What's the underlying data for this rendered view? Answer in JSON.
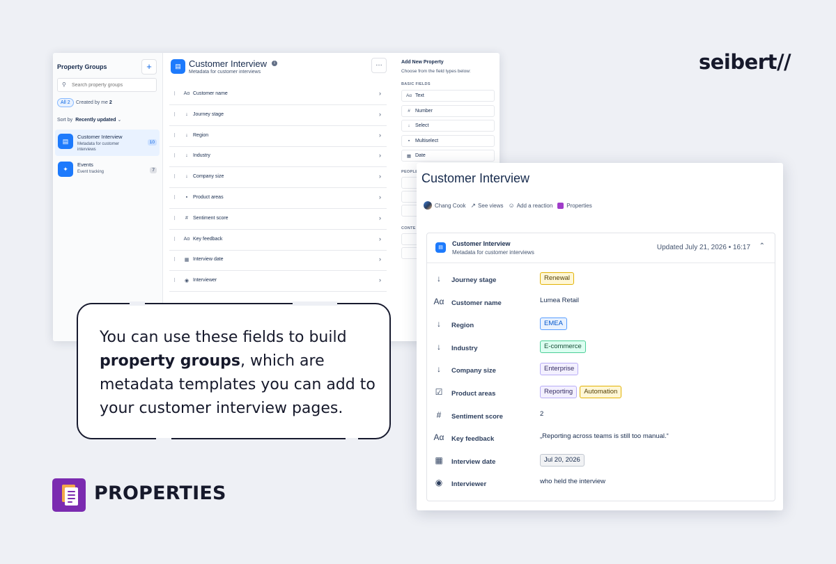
{
  "brand": "seibert//",
  "property_groups": {
    "title": "Property Groups",
    "add_label": "+",
    "search_placeholder": "Search property groups",
    "filters": [
      {
        "label": "All",
        "count": "2"
      },
      {
        "label": "Created by me",
        "count": "2"
      }
    ],
    "sort_label": "Sort by",
    "sort_value": "Recently updated",
    "groups": [
      {
        "name": "Customer Interview",
        "description": "Metadata for customer interviews",
        "count": "10"
      },
      {
        "name": "Events",
        "description": "Event tracking",
        "count": "7"
      }
    ]
  },
  "editor": {
    "title": "Customer Interview",
    "subtitle": "Metadata for customer interviews",
    "more_label": "…",
    "fields": [
      {
        "icon": "text-icon",
        "glyph": "Aα",
        "label": "Customer name"
      },
      {
        "icon": "select-icon",
        "glyph": "↓",
        "label": "Journey stage"
      },
      {
        "icon": "select-icon",
        "glyph": "↓",
        "label": "Region"
      },
      {
        "icon": "select-icon",
        "glyph": "↓",
        "label": "Industry"
      },
      {
        "icon": "select-icon",
        "glyph": "↓",
        "label": "Company size"
      },
      {
        "icon": "multiselect-icon",
        "glyph": "▪",
        "label": "Product areas"
      },
      {
        "icon": "number-icon",
        "glyph": "#",
        "label": "Sentiment score"
      },
      {
        "icon": "text-icon",
        "glyph": "Aα",
        "label": "Key feedback"
      },
      {
        "icon": "calendar-icon",
        "glyph": "▦",
        "label": "Interview date"
      },
      {
        "icon": "person-icon",
        "glyph": "◉",
        "label": "Interviewer"
      }
    ]
  },
  "add_property": {
    "title": "Add New Property",
    "subtitle": "Choose from the field types below:",
    "basic_label": "BASIC FIELDS",
    "basic_fields": [
      {
        "icon": "text-icon",
        "glyph": "Aα",
        "label": "Text"
      },
      {
        "icon": "number-icon",
        "glyph": "#",
        "label": "Number"
      },
      {
        "icon": "select-icon",
        "glyph": "↓",
        "label": "Select"
      },
      {
        "icon": "multiselect-icon",
        "glyph": "▪",
        "label": "Multiselect"
      },
      {
        "icon": "calendar-icon",
        "glyph": "▦",
        "label": "Date"
      }
    ],
    "people_label": "PEOPLE",
    "content_label": "CONTE"
  },
  "callout": {
    "line1": "You can use these fields to build",
    "bold": "property groups",
    "line2": ", which are metadata templates you can add to your customer interview pages."
  },
  "product_name": "PROPERTIES",
  "page": {
    "title": "Customer Interview",
    "author": "Chang Cook",
    "see_views": "See views",
    "add_reaction": "Add a reaction",
    "properties_link": "Properties",
    "card": {
      "title": "Customer Interview",
      "subtitle": "Metadata for customer interviews",
      "updated": "Updated July 21, 2026 • 16:17",
      "rows": [
        {
          "label": "Journey stage",
          "glyph": "↓",
          "icon": "select-icon",
          "tags": [
            {
              "text": "Renewal",
              "bg": "#fff7d6",
              "border": "#e2b203",
              "fg": "#533f04"
            }
          ]
        },
        {
          "label": "Customer name",
          "glyph": "Aα",
          "icon": "text-icon",
          "value": "Lumea Retail"
        },
        {
          "label": "Region",
          "glyph": "↓",
          "icon": "select-icon",
          "tags": [
            {
              "text": "EMEA",
              "bg": "#e9f2ff",
              "border": "#579dff",
              "fg": "#0055cc"
            }
          ]
        },
        {
          "label": "Industry",
          "glyph": "↓",
          "icon": "select-icon",
          "tags": [
            {
              "text": "E-commerce",
              "bg": "#dcfff1",
              "border": "#4bce97",
              "fg": "#164b35"
            }
          ]
        },
        {
          "label": "Company size",
          "glyph": "↓",
          "icon": "select-icon",
          "tags": [
            {
              "text": "Enterprise",
              "bg": "#f3f0ff",
              "border": "#b8acf6",
              "fg": "#352c63"
            }
          ]
        },
        {
          "label": "Product areas",
          "glyph": "☑",
          "icon": "checkbox-icon",
          "tags": [
            {
              "text": "Reporting",
              "bg": "#f3f0ff",
              "border": "#b8acf6",
              "fg": "#352c63"
            },
            {
              "text": "Automation",
              "bg": "#fff7d6",
              "border": "#e2b203",
              "fg": "#533f04"
            }
          ]
        },
        {
          "label": "Sentiment score",
          "glyph": "#",
          "icon": "number-icon",
          "value": "2"
        },
        {
          "label": "Key feedback",
          "glyph": "Aα",
          "icon": "text-icon",
          "value": "„Reporting across teams is still too manual.“"
        },
        {
          "label": "Interview date",
          "glyph": "▦",
          "icon": "calendar-icon",
          "tags": [
            {
              "text": "Jul 20, 2026",
              "bg": "#f1f2f4",
              "border": "#c1c7d0",
              "fg": "#172b4d"
            }
          ]
        },
        {
          "label": "Interviewer",
          "glyph": "◉",
          "icon": "person-icon",
          "value": "who held the interview"
        }
      ]
    }
  }
}
